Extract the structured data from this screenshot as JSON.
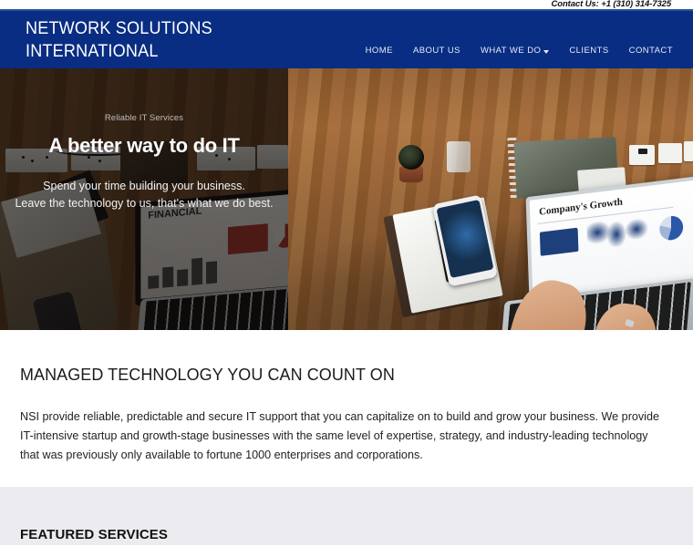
{
  "topbar": {
    "contact": "Contact Us: +1 (310) 314-7325"
  },
  "header": {
    "logo_line1": "NETWORK SOLUTIONS",
    "logo_line2": "INTERNATIONAL",
    "nav": [
      {
        "label": "HOME"
      },
      {
        "label": "ABOUT US"
      },
      {
        "label": "WHAT WE DO",
        "has_dropdown": true
      },
      {
        "label": "CLIENTS"
      },
      {
        "label": "CONTACT"
      }
    ]
  },
  "hero": {
    "eyebrow": "Reliable IT Services",
    "heading": "A better way to do IT",
    "sub_line1": "Spend your time building your business.",
    "sub_line2": "Leave the technology to us, that's what we do best.",
    "laptop_screen_title": "Company's Growth",
    "left_laptop_screen_title": "FINANCIAL"
  },
  "main": {
    "heading": "MANAGED TECHNOLOGY YOU CAN COUNT ON",
    "paragraph": "NSI provide reliable, predictable and secure IT support that you can capitalize on to build and grow your business. We provide IT-intensive startup and growth-stage businesses with the same level of expertise, strategy, and industry-leading technology that was previously only available to fortune 1000 enterprises and corporations."
  },
  "featured": {
    "heading": "FEATURED SERVICES"
  },
  "colors": {
    "navy": "#082d82",
    "accent_rule": "#2c4fa0",
    "featured_bg": "#ecebf0",
    "body_text": "#222222"
  }
}
